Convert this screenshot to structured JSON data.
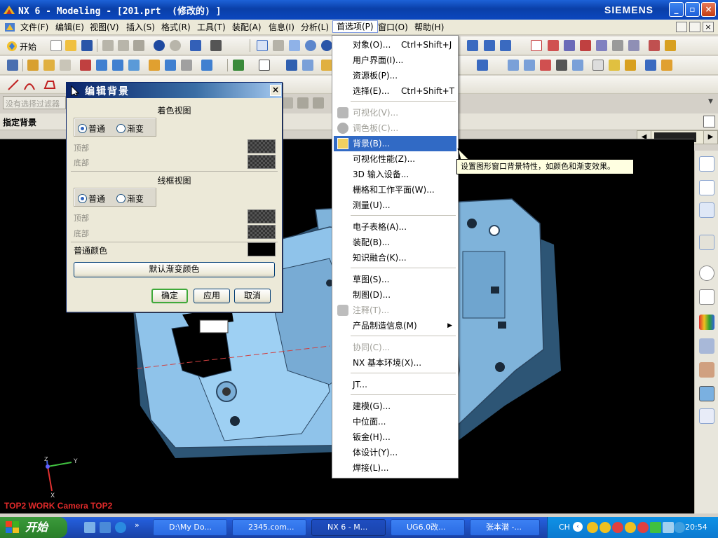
{
  "window": {
    "title": "NX 6 - Modeling - [201.prt  (修改的) ]",
    "brand": "SIEMENS"
  },
  "menubar": {
    "items": [
      "文件(F)",
      "编辑(E)",
      "视图(V)",
      "插入(S)",
      "格式(R)",
      "工具(T)",
      "装配(A)",
      "信息(I)",
      "分析(L)",
      "首选项(P)",
      "窗口(O)",
      "帮助(H)"
    ]
  },
  "toolbar": {
    "start_label": "开始"
  },
  "filter": {
    "placeholder": "没有选择过滤器"
  },
  "cue": {
    "text": "指定背景"
  },
  "dialog": {
    "title": "编辑背景",
    "shaded_title": "着色视图",
    "wire_title": "线框视图",
    "opt_plain": "普通",
    "opt_gradient": "渐变",
    "top_label": "顶部",
    "bottom_label": "底部",
    "plain_color_label": "普通颜色",
    "default_gradient": "默认渐变颜色",
    "ok": "确定",
    "apply": "应用",
    "cancel": "取消"
  },
  "menu": {
    "items": [
      {
        "label": "对象(O)...",
        "shortcut": "Ctrl+Shift+J"
      },
      {
        "label": "用户界面(I)..."
      },
      {
        "label": "资源板(P)..."
      },
      {
        "label": "选择(E)...",
        "shortcut": "Ctrl+Shift+T"
      },
      {
        "label": "可视化(V)...",
        "disabled": true
      },
      {
        "label": "调色板(C)...",
        "disabled": true
      },
      {
        "label": "背景(B)...",
        "highlighted": true
      },
      {
        "label": "可视化性能(Z)..."
      },
      {
        "label": "3D 输入设备..."
      },
      {
        "label": "栅格和工作平面(W)..."
      },
      {
        "label": "测量(U)..."
      },
      {
        "label": "电子表格(A)..."
      },
      {
        "label": "装配(B)..."
      },
      {
        "label": "知识融合(K)..."
      },
      {
        "label": "草图(S)..."
      },
      {
        "label": "制图(D)..."
      },
      {
        "label": "注释(T)...",
        "disabled": true
      },
      {
        "label": "产品制造信息(M)",
        "submenu": true
      },
      {
        "label": "协同(C)...",
        "disabled": true
      },
      {
        "label": "NX 基本环境(X)..."
      },
      {
        "label": "JT..."
      },
      {
        "label": "建模(G)..."
      },
      {
        "label": "中位面..."
      },
      {
        "label": "钣金(H)..."
      },
      {
        "label": "体设计(Y)..."
      },
      {
        "label": "焊接(L)..."
      }
    ]
  },
  "tooltip": {
    "text": "设置图形窗口背景特性，如颜色和渐变效果。"
  },
  "viewport": {
    "info": "TOP2 WORK Camera TOP2",
    "axis_x": "X",
    "axis_y": "Y",
    "axis_z": "Z",
    "bg": "#000000",
    "part_color": "#87b8e0"
  },
  "taskbar": {
    "start": "开始",
    "tasks": [
      "D:\\My Do...",
      "2345.com...",
      "NX 6 - M...",
      "UG6.0改...",
      "张本潜 -..."
    ],
    "lang": "CH",
    "clock": "20:54"
  }
}
